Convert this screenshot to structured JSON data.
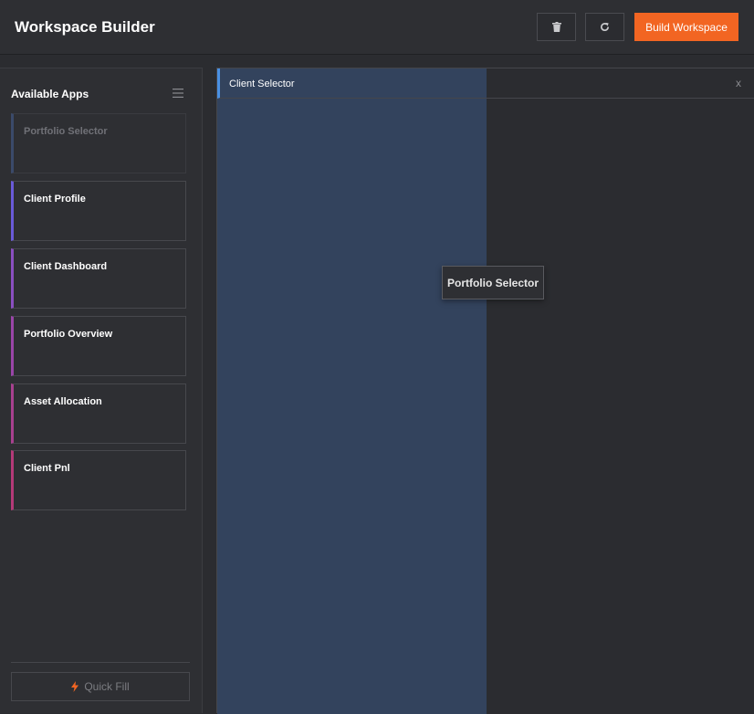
{
  "header": {
    "title": "Workspace Builder",
    "delete_icon": "trash-icon",
    "refresh_icon": "refresh-icon",
    "build_label": "Build Workspace"
  },
  "sidebar": {
    "title": "Available Apps",
    "menu_icon": "menu-icon",
    "apps": [
      {
        "label": "Portfolio Selector",
        "color": "#3b4a6a",
        "state": "dragging"
      },
      {
        "label": "Client Profile",
        "color": "#6a5ad8"
      },
      {
        "label": "Client Dashboard",
        "color": "#8a4fc0"
      },
      {
        "label": "Portfolio Overview",
        "color": "#9a45a8"
      },
      {
        "label": "Asset Allocation",
        "color": "#a8408f"
      },
      {
        "label": "Client Pnl",
        "color": "#b43a78"
      }
    ],
    "quick_fill_label": "Quick Fill",
    "quick_fill_icon": "lightning-icon"
  },
  "canvas": {
    "panel_title": "Client Selector",
    "panel_close": "x",
    "drag_ghost_label": "Portfolio Selector",
    "drop_highlight_color": "#344561"
  },
  "colors": {
    "accent": "#f26522",
    "panel_accent": "#4a90e2"
  }
}
